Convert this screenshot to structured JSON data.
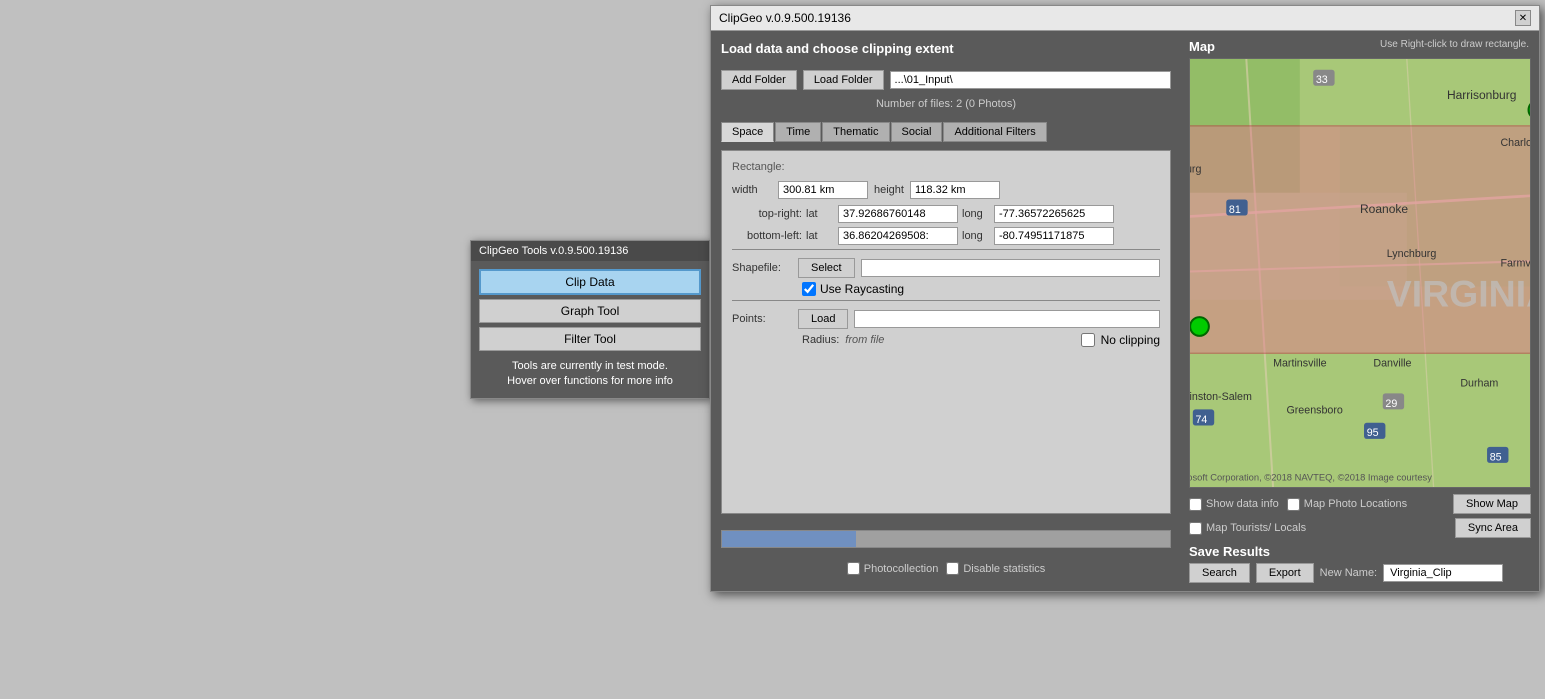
{
  "tools_window": {
    "title": "ClipGeo Tools v.0.9.500.19136",
    "buttons": [
      {
        "label": "Clip Data",
        "id": "clip-data",
        "active": true
      },
      {
        "label": "Graph Tool",
        "id": "graph-tool",
        "active": false
      },
      {
        "label": "Filter Tool",
        "id": "filter-tool",
        "active": false
      }
    ],
    "info_line1": "Tools are currently in test mode.",
    "info_line2": "Hover over functions for more info"
  },
  "main_window": {
    "title": "ClipGeo v.0.9.500.19136",
    "close_label": "✕",
    "section_title": "Load data and choose clipping extent",
    "add_folder_btn": "Add Folder",
    "load_folder_btn": "Load Folder",
    "folder_path": "...\\01_Input\\",
    "file_count": "Number of files: 2 (0 Photos)",
    "tabs": [
      {
        "label": "Space",
        "active": true
      },
      {
        "label": "Time",
        "active": false
      },
      {
        "label": "Thematic",
        "active": false
      },
      {
        "label": "Social",
        "active": false
      },
      {
        "label": "Additional Filters",
        "active": false
      }
    ],
    "rectangle_label": "Rectangle:",
    "width_label": "width",
    "width_value": "300.81 km",
    "height_label": "height",
    "height_value": "118.32 km",
    "top_right_label": "top-right:",
    "lat_label_tr": "lat",
    "lat_value_tr": "37.92686760148",
    "long_label_tr": "long",
    "long_value_tr": "-77.36572265625",
    "bottom_left_label": "bottom-left:",
    "lat_label_bl": "lat",
    "lat_value_bl": "36.86204269508:",
    "long_label_bl": "long",
    "long_value_bl": "-80.74951171875",
    "shapefile_label": "Shapefile:",
    "select_btn": "Select",
    "shapefile_value": "",
    "use_raycasting_label": "Use Raycasting",
    "points_label": "Points:",
    "load_btn": "Load",
    "points_value": "",
    "radius_label": "Radius:",
    "radius_value": "from file",
    "no_clipping_label": "No clipping",
    "photocollection_label": "Photocollection",
    "disable_stats_label": "Disable statistics",
    "map_title": "Map",
    "map_hint": "Use Right-click to draw rectangle.",
    "show_data_info_label": "Show data info",
    "map_photo_locations_label": "Map Photo Locations",
    "map_tourists_label": "Map Tourists/ Locals",
    "show_map_btn": "Show Map",
    "sync_area_btn": "Sync Area",
    "save_results_title": "Save Results",
    "search_btn": "Search",
    "export_btn": "Export",
    "new_name_label": "New Name:",
    "new_name_value": "Virginia_Clip"
  }
}
